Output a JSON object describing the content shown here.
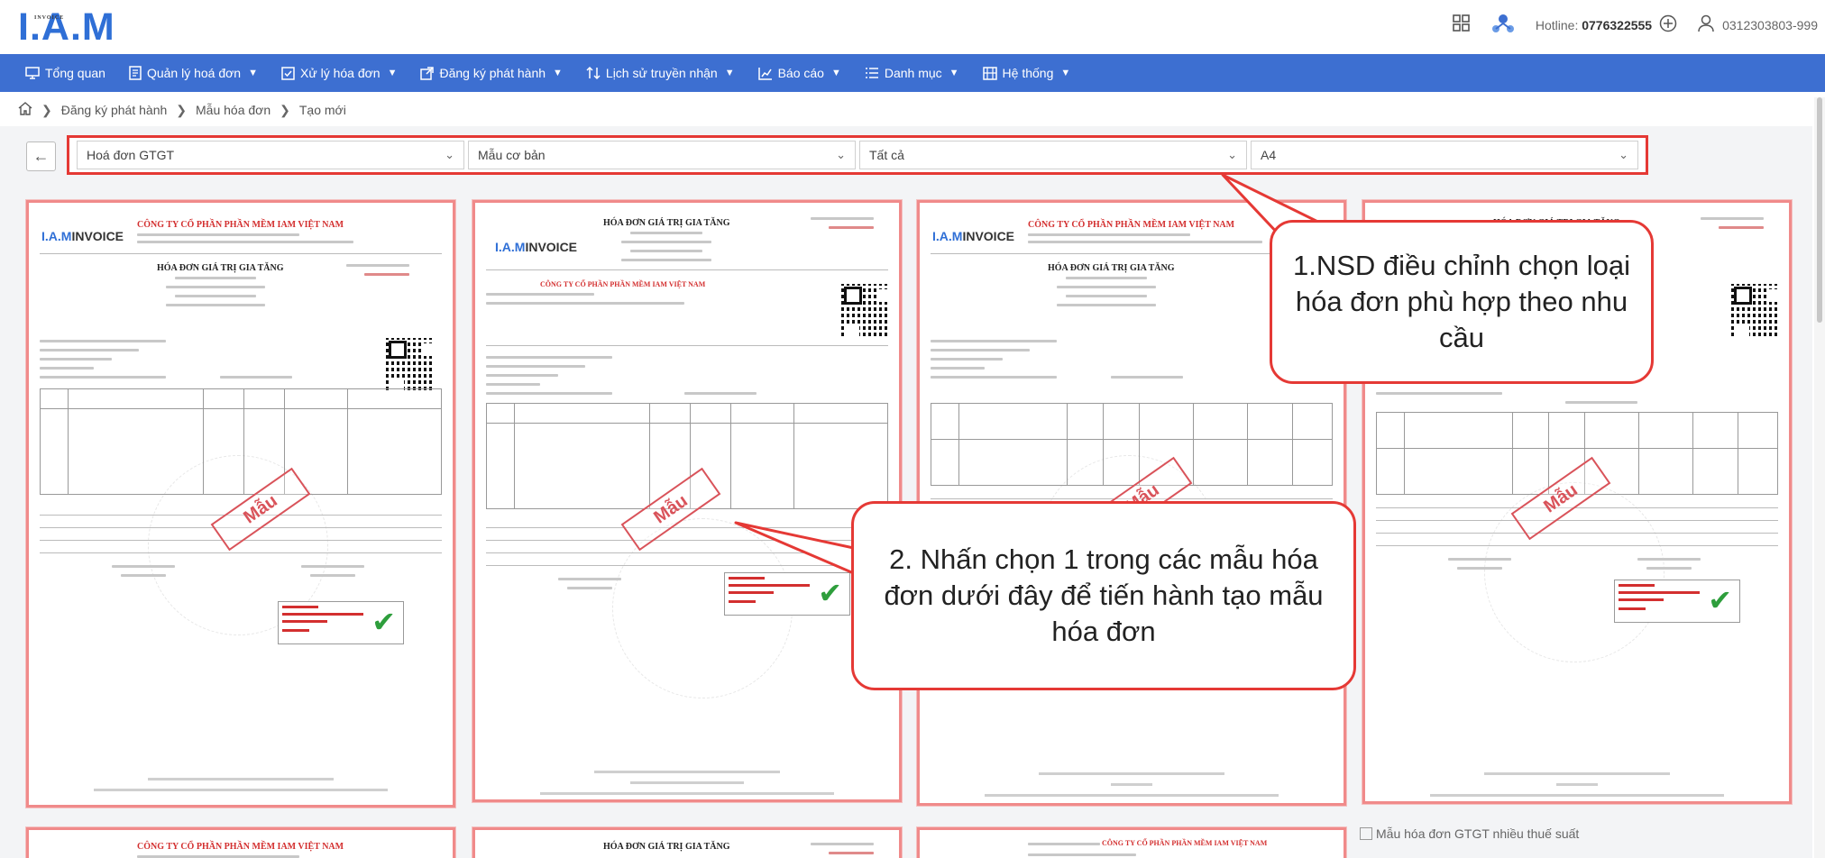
{
  "header": {
    "logo_prefix": "I.A.M",
    "logo_suffix": "INVOICE",
    "hotline_label": "Hotline:",
    "hotline_number": "0776322555",
    "tax_code": "0312303803-999"
  },
  "nav": [
    {
      "label": "Tổng quan",
      "icon": "monitor-icon",
      "dropdown": false
    },
    {
      "label": "Quản lý hoá đơn",
      "icon": "document-icon",
      "dropdown": true
    },
    {
      "label": "Xử lý hóa đơn",
      "icon": "checkbox-icon",
      "dropdown": true
    },
    {
      "label": "Đăng ký phát hành",
      "icon": "external-link-icon",
      "dropdown": true
    },
    {
      "label": "Lịch sử truyền nhận",
      "icon": "transfer-icon",
      "dropdown": true
    },
    {
      "label": "Báo cáo",
      "icon": "chart-icon",
      "dropdown": true
    },
    {
      "label": "Danh mục",
      "icon": "list-icon",
      "dropdown": true
    },
    {
      "label": "Hệ thống",
      "icon": "system-icon",
      "dropdown": true
    }
  ],
  "breadcrumb": [
    "Đăng ký phát hành",
    "Mẫu hóa đơn",
    "Tạo mới"
  ],
  "filters": {
    "invoice_type": "Hoá đơn GTGT",
    "template_style": "Mẫu cơ bản",
    "category": "Tất cả",
    "paper_size": "A4"
  },
  "templates": {
    "company": "CÔNG TY CỔ PHẦN PHẦN MỀM IAM VIỆT NAM",
    "title": "HÓA ĐƠN GIÁ TRỊ GIA TĂNG",
    "stamp": "Mẫu",
    "broken_image_alt": "Mẫu hóa đơn GTGT nhiều thuế suất"
  },
  "callouts": {
    "step1": "1.NSD điều chỉnh chọn loại hóa đơn phù hợp theo nhu cầu",
    "step2": "2. Nhấn chọn 1 trong các mẫu hóa đơn dưới đây để tiến hành tạo mẫu hóa đơn"
  },
  "colors": {
    "nav_bg": "#3d6fd1",
    "highlight": "#e53935",
    "brand_blue": "#2f6fd6"
  }
}
